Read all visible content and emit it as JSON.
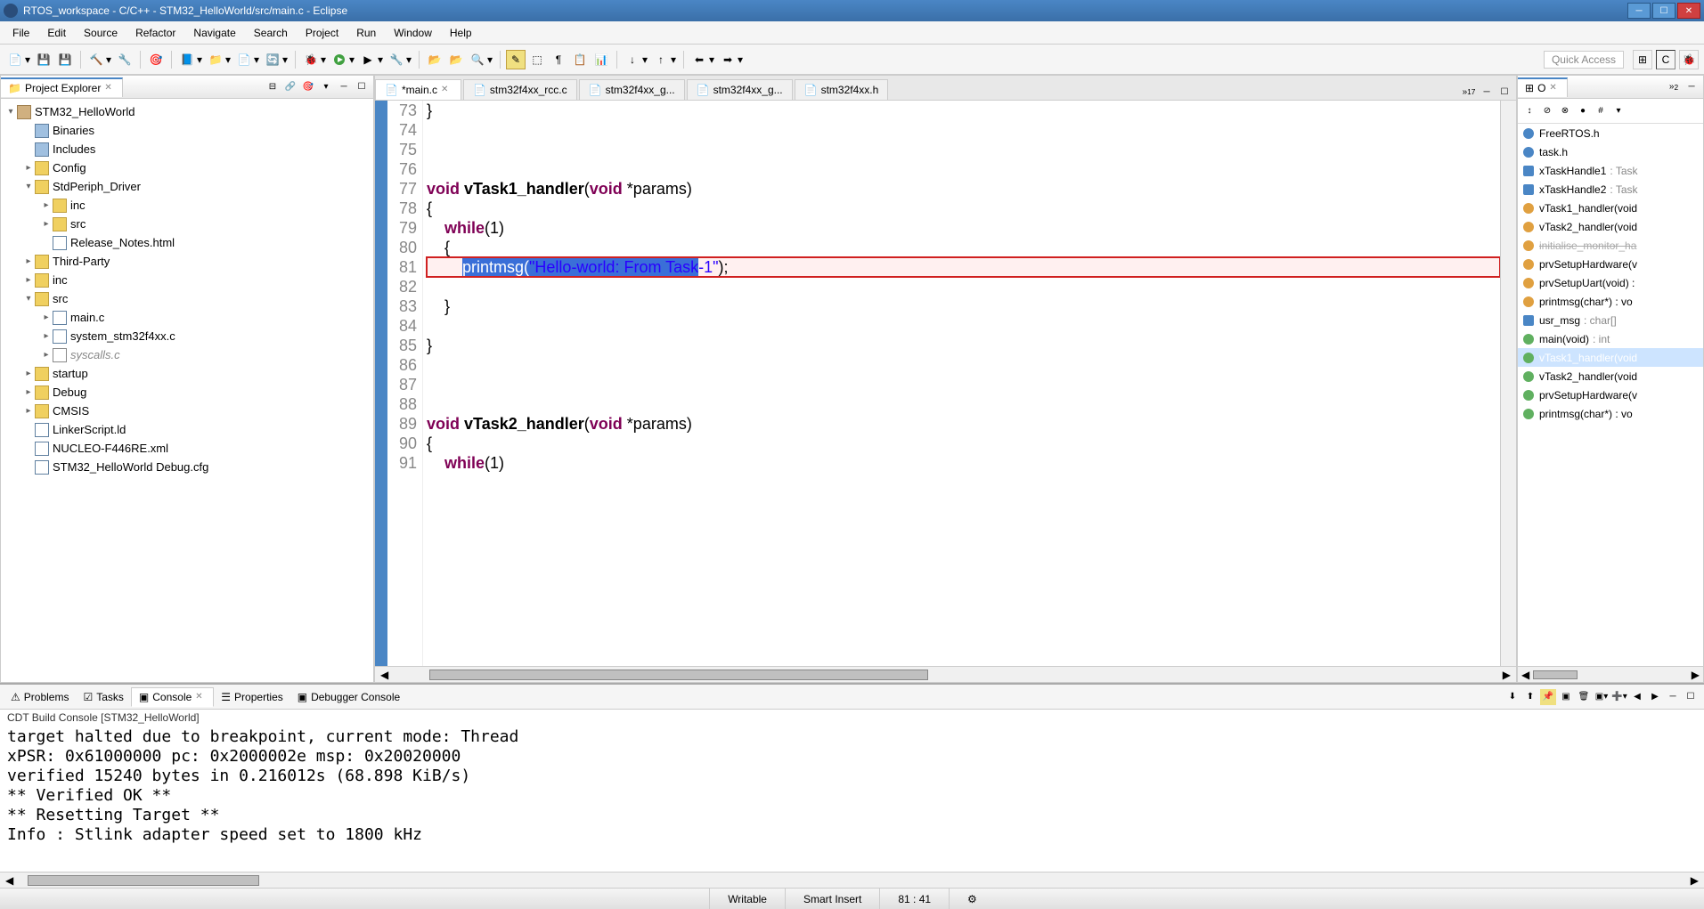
{
  "window_title": "RTOS_workspace - C/C++ - STM32_HelloWorld/src/main.c - Eclipse",
  "menu": [
    "File",
    "Edit",
    "Source",
    "Refactor",
    "Navigate",
    "Search",
    "Project",
    "Run",
    "Window",
    "Help"
  ],
  "quick_access": "Quick Access",
  "project_explorer": {
    "title": "Project Explorer",
    "tree": {
      "root": "STM32_HelloWorld",
      "items": [
        {
          "label": "Binaries",
          "depth": 1,
          "icon": "bin",
          "exp": "leaf"
        },
        {
          "label": "Includes",
          "depth": 1,
          "icon": "inc",
          "exp": "leaf"
        },
        {
          "label": "Config",
          "depth": 1,
          "icon": "folder",
          "exp": "col"
        },
        {
          "label": "StdPeriph_Driver",
          "depth": 1,
          "icon": "folder",
          "exp": "exp"
        },
        {
          "label": "inc",
          "depth": 2,
          "icon": "folder",
          "exp": "col"
        },
        {
          "label": "src",
          "depth": 2,
          "icon": "folder",
          "exp": "col"
        },
        {
          "label": "Release_Notes.html",
          "depth": 2,
          "icon": "file",
          "exp": "leaf"
        },
        {
          "label": "Third-Party",
          "depth": 1,
          "icon": "folder",
          "exp": "col"
        },
        {
          "label": "inc",
          "depth": 1,
          "icon": "folder",
          "exp": "col"
        },
        {
          "label": "src",
          "depth": 1,
          "icon": "folder",
          "exp": "exp"
        },
        {
          "label": "main.c",
          "depth": 2,
          "icon": "cfile",
          "exp": "col"
        },
        {
          "label": "system_stm32f4xx.c",
          "depth": 2,
          "icon": "cfile",
          "exp": "col"
        },
        {
          "label": "syscalls.c",
          "depth": 2,
          "icon": "gfile",
          "exp": "col"
        },
        {
          "label": "startup",
          "depth": 1,
          "icon": "folder",
          "exp": "col"
        },
        {
          "label": "Debug",
          "depth": 1,
          "icon": "folder",
          "exp": "col"
        },
        {
          "label": "CMSIS",
          "depth": 1,
          "icon": "folder",
          "exp": "col"
        },
        {
          "label": "LinkerScript.ld",
          "depth": 1,
          "icon": "file",
          "exp": "leaf"
        },
        {
          "label": "NUCLEO-F446RE.xml",
          "depth": 1,
          "icon": "file",
          "exp": "leaf"
        },
        {
          "label": "STM32_HelloWorld Debug.cfg",
          "depth": 1,
          "icon": "file",
          "exp": "leaf"
        }
      ]
    }
  },
  "editor": {
    "tabs": [
      {
        "label": "main.c",
        "active": true,
        "dirty": true
      },
      {
        "label": "stm32f4xx_rcc.c",
        "active": false
      },
      {
        "label": "stm32f4xx_g...",
        "active": false
      },
      {
        "label": "stm32f4xx_g...",
        "active": false
      },
      {
        "label": "stm32f4xx.h",
        "active": false
      }
    ],
    "overflow_count": "17",
    "lines": {
      "l73": "}",
      "l74": "",
      "l75": "",
      "l76": "",
      "l77_kw1": "void",
      "l77_fn": "vTask1_handler",
      "l77_rest": "(",
      "l77_kw2": "void",
      "l77_rest2": " *params)",
      "l78": "{",
      "l79_ind": "    ",
      "l79_kw": "while",
      "l79_rest": "(1)",
      "l80": "    {",
      "l81_ind": "        ",
      "l81_fn": "printmsg",
      "l81_p": "(",
      "l81_str": "\"Hello-world: From Task-1\"",
      "l81_end": ");",
      "l82": "",
      "l83": "    }",
      "l84": "",
      "l85": "}",
      "l86": "",
      "l87": "",
      "l88": "",
      "l89_kw1": "void",
      "l89_fn": "vTask2_handler",
      "l89_rest": "(",
      "l89_kw2": "void",
      "l89_rest2": " *params)",
      "l90": "{",
      "l91_ind": "    ",
      "l91_kw": "while",
      "l91_rest": "(1)"
    },
    "line_numbers": [
      "73",
      "74",
      "75",
      "76",
      "77",
      "78",
      "79",
      "80",
      "81",
      "82",
      "83",
      "84",
      "85",
      "86",
      "87",
      "88",
      "89",
      "90",
      "91"
    ]
  },
  "outline": {
    "tab_o": "O",
    "items": [
      {
        "label": "FreeRTOS.h",
        "icon": "inc"
      },
      {
        "label": "task.h",
        "icon": "inc"
      },
      {
        "label": "xTaskHandle1",
        "type": ": Task",
        "icon": "var"
      },
      {
        "label": "xTaskHandle2",
        "type": ": Task",
        "icon": "var"
      },
      {
        "label": "vTask1_handler(void",
        "icon": "fn-o"
      },
      {
        "label": "vTask2_handler(void",
        "icon": "fn-o"
      },
      {
        "label": "initialise_monitor_ha",
        "icon": "fn-o",
        "dim": true
      },
      {
        "label": "prvSetupHardware(v",
        "icon": "fn-o"
      },
      {
        "label": "prvSetupUart(void) :",
        "icon": "fn-o"
      },
      {
        "label": "printmsg(char*) : vo",
        "icon": "fn-o"
      },
      {
        "label": "usr_msg",
        "type": ": char[]",
        "icon": "var"
      },
      {
        "label": "main(void)",
        "type": ": int",
        "icon": "fn-g"
      },
      {
        "label": "vTask1_handler(void",
        "icon": "fn-g",
        "sel": true
      },
      {
        "label": "vTask2_handler(void",
        "icon": "fn-g"
      },
      {
        "label": "prvSetupHardware(v",
        "icon": "fn-g"
      },
      {
        "label": "printmsg(char*) : vo",
        "icon": "fn-g"
      }
    ]
  },
  "bottom": {
    "tabs": [
      "Problems",
      "Tasks",
      "Console",
      "Properties",
      "Debugger Console"
    ],
    "active": 2,
    "console_title": "CDT Build Console [STM32_HelloWorld]",
    "lines": [
      "target halted due to breakpoint, current mode: Thread",
      "xPSR: 0x61000000 pc: 0x2000002e msp: 0x20020000",
      "verified 15240 bytes in 0.216012s (68.898 KiB/s)",
      "** Verified OK **",
      "** Resetting Target **",
      "Info : Stlink adapter speed set to 1800 kHz"
    ]
  },
  "status": {
    "writable": "Writable",
    "insert": "Smart Insert",
    "pos": "81 : 41"
  }
}
